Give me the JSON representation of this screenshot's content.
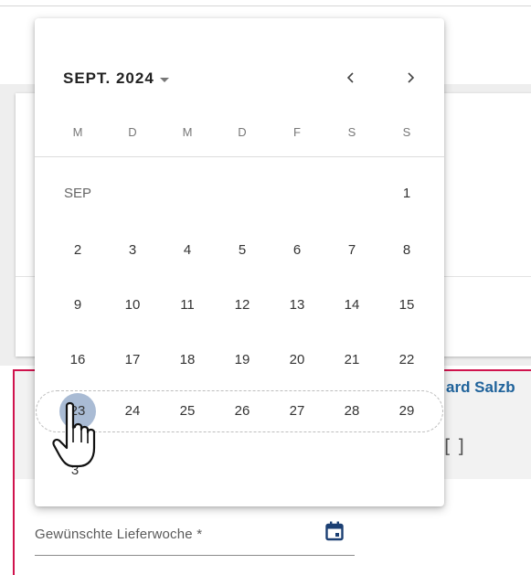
{
  "product_card": {
    "title": "ard Salzb",
    "subtitle": "[ ]"
  },
  "delivery_field": {
    "label": "Gewünschte Lieferwoche *",
    "icon": "calendar-icon"
  },
  "datepicker": {
    "period_label": "SEPT. 2024",
    "period_icon": "caret-down-icon",
    "prev_icon": "chevron-left-icon",
    "next_icon": "chevron-right-icon",
    "weekdays": [
      "M",
      "D",
      "M",
      "D",
      "F",
      "S",
      "S"
    ],
    "month_label": "SEP",
    "weeks": [
      [
        "",
        "",
        "",
        "",
        "",
        "",
        "1"
      ],
      [
        "2",
        "3",
        "4",
        "5",
        "6",
        "7",
        "8"
      ],
      [
        "9",
        "10",
        "11",
        "12",
        "13",
        "14",
        "15"
      ],
      [
        "16",
        "17",
        "18",
        "19",
        "20",
        "21",
        "22"
      ],
      [
        "23",
        "24",
        "25",
        "26",
        "27",
        "28",
        "29"
      ]
    ],
    "selected_day": "23",
    "partially_hidden_day": "3",
    "selected_color": "#a9bbd4"
  },
  "accent_color": "#d0134d",
  "title_color": "#20639b",
  "cursor_icon": "hand-pointer-icon"
}
